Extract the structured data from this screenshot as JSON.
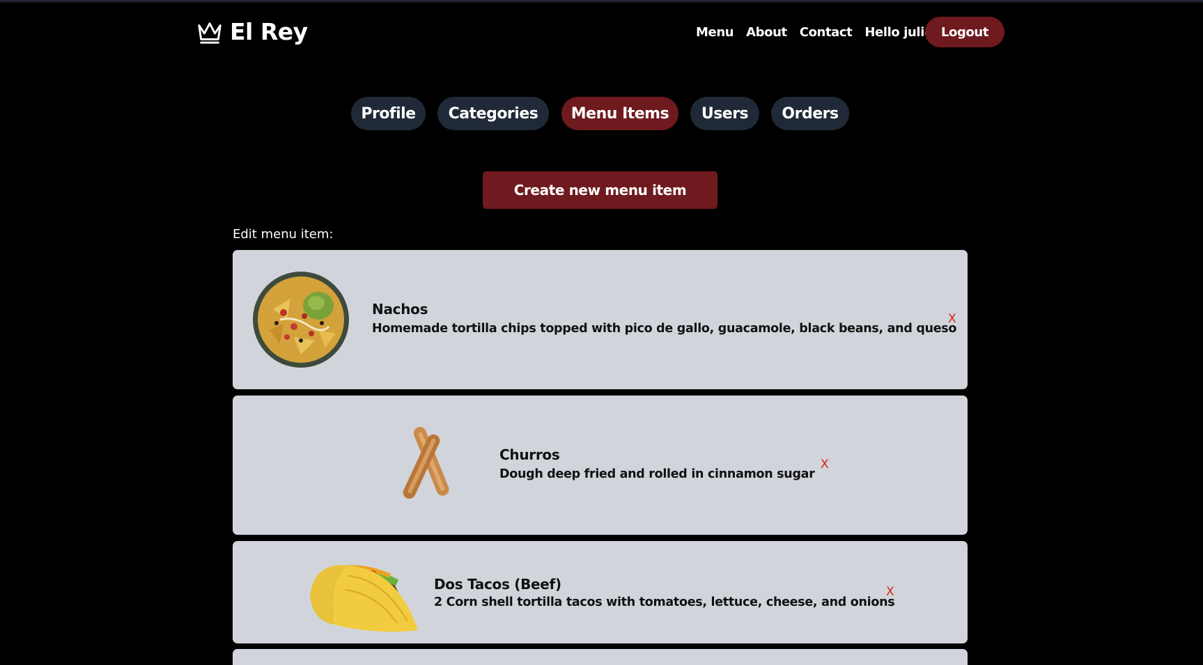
{
  "header": {
    "brand": "El Rey",
    "nav": [
      "Menu",
      "About",
      "Contact",
      "Hello julio"
    ],
    "logout_label": "Logout"
  },
  "tabs": [
    {
      "label": "Profile",
      "active": false
    },
    {
      "label": "Categories",
      "active": false
    },
    {
      "label": "Menu Items",
      "active": true
    },
    {
      "label": "Users",
      "active": false
    },
    {
      "label": "Orders",
      "active": false
    }
  ],
  "main": {
    "create_label": "Create new menu item",
    "edit_label": "Edit menu item:"
  },
  "menu_items": [
    {
      "name": "Nachos",
      "description": "Homemade tortilla chips topped with pico de gallo, guacamole, black beans, and queso",
      "delete_label": "X",
      "image": "nachos-image"
    },
    {
      "name": "Churros",
      "description": "Dough deep fried and rolled in cinnamon sugar",
      "delete_label": "X",
      "image": "churros-image"
    },
    {
      "name": "Dos Tacos (Beef)",
      "description": "2 Corn shell tortilla tacos with tomatoes, lettuce, cheese, and onions",
      "delete_label": "X",
      "image": "taco-image"
    }
  ],
  "colors": {
    "accent": "#6e1a1e",
    "tab_bg": "#1f2937",
    "card_bg": "#d1d5db",
    "delete": "#e01b1b"
  }
}
